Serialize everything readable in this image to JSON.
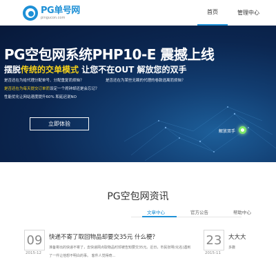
{
  "header": {
    "logo_name": "PG单号网",
    "logo_url": "pingucon.com",
    "nav": [
      {
        "label": "首页",
        "active": true
      },
      {
        "label": "管理中心",
        "active": false
      }
    ]
  },
  "banner": {
    "title": "PG空包网系统PHP10-E 震撼上线",
    "sub_pre": "摆脱",
    "sub_hl": "传统的交单模式",
    "sub_post": " 让您不在OUT 解放您的双手",
    "q1": "是否还在为给代理分配单号、分配重复而烦恼？",
    "q1b": "是否还在为某些无赖的代理的卷款逃离而烦恼？",
    "q2_pre": "是否还在",
    "q2_hl": "为每天提交订单而",
    "q2_post": "设定一个闹钟却还是会忘记？",
    "q3": "性能优化让网站速度提升60% 和延迟说NO",
    "button": "立即体验",
    "free_hands": "解放双手"
  },
  "news": {
    "section_title": "PG空包网资讯",
    "tabs": [
      "文章中心",
      "官方公告",
      "帮助中心"
    ],
    "items": [
      {
        "day": "09",
        "ym": "2015-12",
        "title": "快递不寄了取回物品却要交35元 什么梗？",
        "desc": "准备寄出的快递不寄了，去快递网点取物品时却被告知要交35元。近日，市民张明(化名)遇到了一件让他想不明白的事。 客件人觉得奇..."
      },
      {
        "day": "23",
        "ym": "2015-11",
        "title": "大大大",
        "desc": "多撒"
      }
    ]
  }
}
